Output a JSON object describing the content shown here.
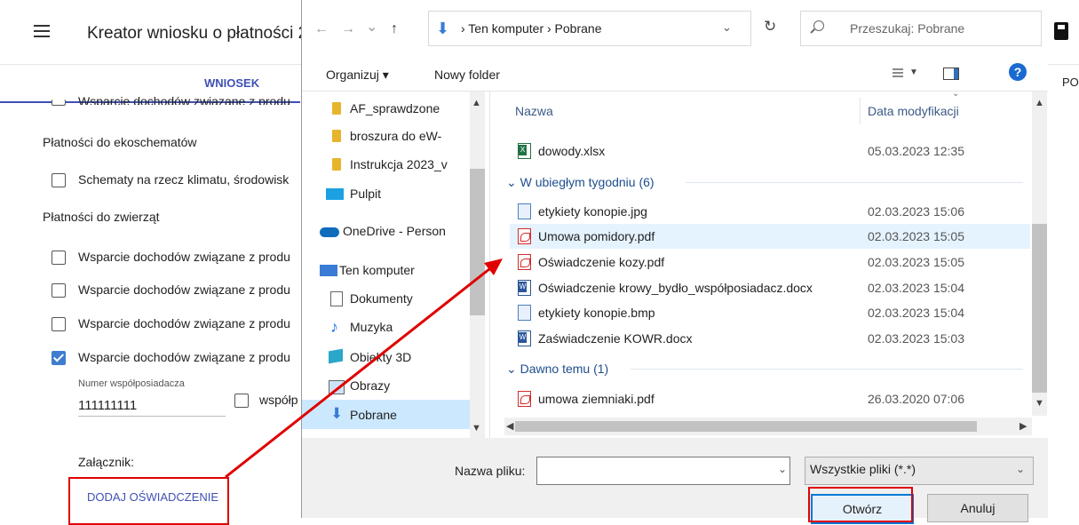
{
  "app": {
    "title": "Kreator wniosku o płatności 2",
    "tab_active": "WNIOSEK",
    "tab_right_partial": "PO",
    "row_cut_top": "Wsparcie dochodów związane z produ",
    "section_eko": "Płatności do ekoschematów",
    "eko_item": "Schematy na rzecz klimatu, środowisk",
    "section_zwierzat": "Płatności do zwierząt",
    "animal_rows": [
      {
        "label": "Wsparcie dochodów związane z produ",
        "checked": false
      },
      {
        "label": "Wsparcie dochodów związane z produ",
        "checked": false
      },
      {
        "label": "Wsparcie dochodów związane z produ",
        "checked": false
      },
      {
        "label": "Wsparcie dochodów związane z produ",
        "checked": true
      }
    ],
    "coowner_label": "Numer współposiadacza",
    "coowner_value": "111111111",
    "coowner_checkbox_label": "współp",
    "attachment_label": "Załącznik:",
    "add_statement_button": "DODAJ OŚWIADCZENIE"
  },
  "dialog": {
    "nav": {
      "back": "←",
      "forward": "→",
      "recent": "⌄",
      "up": "↑",
      "breadcrumb": "›  Ten komputer  ›  Pobrane",
      "search_placeholder": "Przeszukaj: Pobrane"
    },
    "toolbar": {
      "organize": "Organizuj ▾",
      "new_folder": "Nowy folder",
      "help": "?"
    },
    "sidebar": [
      {
        "label": "AF_sprawdzone",
        "icon": "folder-icon"
      },
      {
        "label": "broszura do eW-",
        "icon": "folder-icon"
      },
      {
        "label": "Instrukcja 2023_v",
        "icon": "folder-icon"
      },
      {
        "label": "Pulpit",
        "icon": "desktop-icon"
      },
      {
        "label": "OneDrive - Person",
        "icon": "cloud-icon"
      },
      {
        "label": "Ten komputer",
        "icon": "computer-icon"
      },
      {
        "label": "Dokumenty",
        "icon": "documents-icon"
      },
      {
        "label": "Muzyka",
        "icon": "music-icon"
      },
      {
        "label": "Obiekty 3D",
        "icon": "cube-icon"
      },
      {
        "label": "Obrazy",
        "icon": "pictures-icon"
      },
      {
        "label": "Pobrane",
        "icon": "download-icon"
      }
    ],
    "columns": {
      "name": "Nazwa",
      "date": "Data modyfikacji"
    },
    "top_file": {
      "name": "dowody.xlsx",
      "date": "05.03.2023 12:35"
    },
    "groups": [
      {
        "label": "W ubiegłym tygodniu (6)",
        "files": [
          {
            "name": "etykiety konopie.jpg",
            "date": "02.03.2023 15:06",
            "type": "img"
          },
          {
            "name": "Umowa pomidory.pdf",
            "date": "02.03.2023 15:05",
            "type": "pdf"
          },
          {
            "name": "Oświadczenie kozy.pdf",
            "date": "02.03.2023 15:05",
            "type": "pdf"
          },
          {
            "name": "Oświadczenie krowy_bydło_współposiadacz.docx",
            "date": "02.03.2023 15:04",
            "type": "doc"
          },
          {
            "name": "etykiety konopie.bmp",
            "date": "02.03.2023 15:04",
            "type": "img"
          },
          {
            "name": "Zaświadczenie KOWR.docx",
            "date": "02.03.2023 15:03",
            "type": "doc"
          }
        ]
      },
      {
        "label": "Dawno temu (1)",
        "files": [
          {
            "name": "umowa ziemniaki.pdf",
            "date": "26.03.2020 07:06",
            "type": "pdf"
          }
        ]
      }
    ],
    "filename_label": "Nazwa pliku:",
    "filename_value": "",
    "filter_value": "Wszystkie pliki (*.*)",
    "open_button": "Otwórz",
    "cancel_button": "Anuluj"
  },
  "colors": {
    "accent_app": "#3f51b5",
    "annotation_red": "#e00000",
    "win_blue": "#0078d7"
  }
}
